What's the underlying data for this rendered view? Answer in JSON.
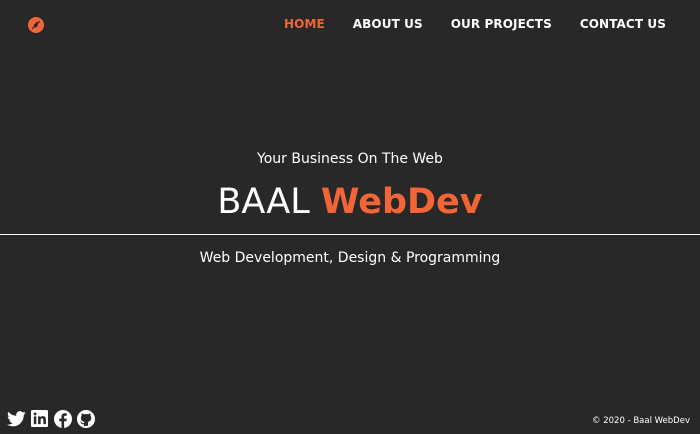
{
  "brand": {
    "logo_icon": "fire-ban-icon",
    "accent_color": "#f26536",
    "background_color": "#282828"
  },
  "nav": {
    "items": [
      {
        "label": "HOME",
        "active": true
      },
      {
        "label": "ABOUT US",
        "active": false
      },
      {
        "label": "OUR PROJECTS",
        "active": false
      },
      {
        "label": "CONTACT US",
        "active": false
      }
    ]
  },
  "hero": {
    "tagline": "Your Business On The Web",
    "title_plain": "BAAL ",
    "title_accent": "WebDev",
    "subtitle": "Web Development, Design & Programming"
  },
  "footer": {
    "socials": [
      {
        "name": "twitter",
        "icon": "twitter-icon"
      },
      {
        "name": "linkedin",
        "icon": "linkedin-icon"
      },
      {
        "name": "facebook",
        "icon": "facebook-icon"
      },
      {
        "name": "github",
        "icon": "github-icon"
      }
    ],
    "copyright": "© 2020 - Baal WebDev"
  }
}
